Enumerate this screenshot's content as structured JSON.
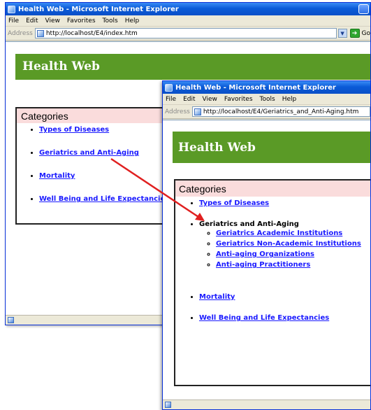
{
  "window1": {
    "title": "Health Web - Microsoft Internet Explorer",
    "menu": [
      "File",
      "Edit",
      "View",
      "Favorites",
      "Tools",
      "Help"
    ],
    "address_label": "Address",
    "url": "http://localhost/E4/index.htm",
    "go_label": "Go",
    "banner": "Health Web",
    "categories_title": "Categories",
    "categories": [
      "Types of Diseases",
      "Geriatrics and Anti-Aging",
      "Mortality",
      "Well Being and Life Expectancies"
    ]
  },
  "window2": {
    "title": "Health Web - Microsoft Internet Explorer",
    "menu": [
      "File",
      "Edit",
      "View",
      "Favorites",
      "Tools",
      "Help"
    ],
    "address_label": "Address",
    "url": "http://localhost/E4/Geriatrics_and_Anti-Aging.htm",
    "banner": "Health Web",
    "categories_title": "Categories",
    "categories": [
      "Types of Diseases",
      "Geriatrics and Anti-Aging",
      "Mortality",
      "Well Being and Life Expectancies"
    ],
    "subcategories": [
      "Geriatrics Academic Institutions",
      "Geriatrics Non-Academic Institutions",
      "Anti-aging Organizations",
      "Anti-aging Practitioners"
    ]
  },
  "colors": {
    "banner_green": "#5a9a26",
    "category_header_pink": "#fadcdc",
    "link_blue": "#1a1aff",
    "arrow_red": "#e02020",
    "titlebar_blue": "#0a5bd8"
  },
  "icons": [
    "ie-page-icon",
    "go-arrow-icon",
    "dropdown-arrow-icon",
    "window-control-icon"
  ]
}
